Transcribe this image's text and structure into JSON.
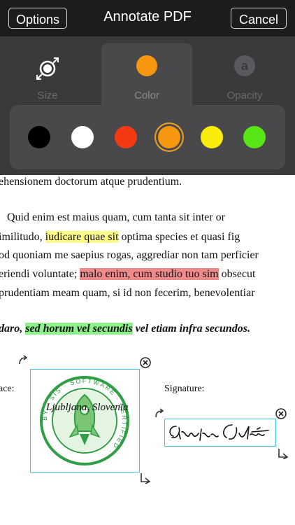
{
  "header": {
    "options_label": "Options",
    "title": "Annotate PDF",
    "cancel_label": "Cancel"
  },
  "tabs": [
    {
      "label": "Size",
      "icon": "resize-icon"
    },
    {
      "label": "Color",
      "icon": "color-dot-icon"
    },
    {
      "label": "Opacity",
      "icon": "opacity-icon",
      "icon_letter": "a"
    }
  ],
  "active_tab": "Color",
  "selected_color": "#f7960f",
  "colors": [
    "#000000",
    "#ffffff",
    "#f33a12",
    "#f7960f",
    "#f9ec0d",
    "#58e515"
  ],
  "document": {
    "line0": "ehensionem doctorum atque prudentium.",
    "line1": "Quid enim est maius quam, cum tanta sit inter or",
    "line2_pre": "imilitudo, ",
    "line2_hl": "iudicare quae sit",
    "line2_post": " optima species et quasi fig",
    "line3": "od quoniam me saepius rogas, aggrediar non tam perficier",
    "line4_pre": "eriendi voluntate; ",
    "line4_hl": "malo enim, cum studio tuo sim",
    "line4_post": " obsecut",
    "line5": "prudentiam meam quam, si id non fecerim, benevolentiar",
    "line6_pre": "daro, ",
    "line6_hl": "sed horum vel secundis",
    "line6_post": " vel etiam infra secundos.",
    "place_label": "ace:",
    "signature_label": "Signature:",
    "stamp_text": "Ljubljana, Slovenia",
    "stamp_ring_text": "BY · SIS · SOFTWARE · CERTIFIED ·"
  }
}
